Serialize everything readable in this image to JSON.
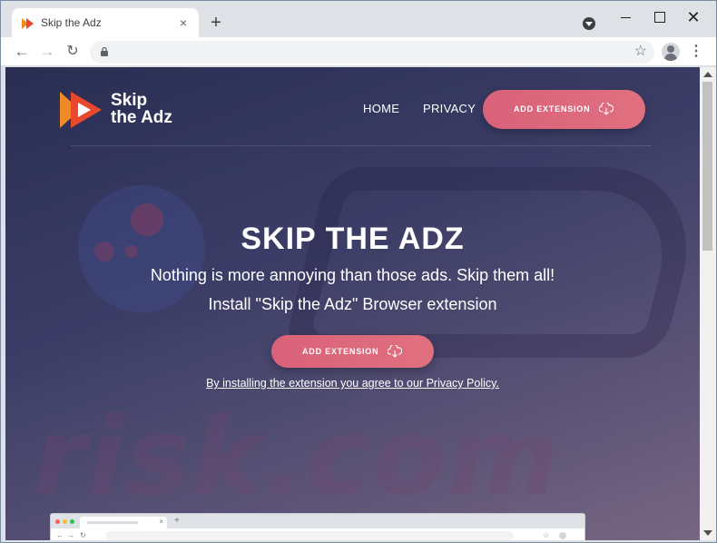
{
  "browser": {
    "tab_title": "Skip the Adz",
    "tab_close": "×",
    "new_tab": "+",
    "window_close": "✕",
    "star": "☆",
    "menu": "⋮"
  },
  "site": {
    "logo_line1": "Skip",
    "logo_line2": "the Adz",
    "nav": {
      "home": "HOME",
      "privacy": "PRIVACY",
      "cta": "ADD EXTENSION"
    },
    "hero": {
      "title": "SKIP THE ADZ",
      "subtitle1": "Nothing is more annoying than those ads. Skip them all!",
      "subtitle2": "Install \"Skip the Adz\" Browser extension",
      "cta": "ADD EXTENSION",
      "policy": "By installing the extension you agree to our Privacy Policy."
    },
    "watermark": "risk.com"
  },
  "colors": {
    "accent": "#d9627a",
    "logo_orange": "#f08a24",
    "logo_red": "#e8482c"
  },
  "icons": [
    "play-logo-icon",
    "close-icon",
    "plus-icon",
    "back-icon",
    "forward-icon",
    "reload-icon",
    "lock-icon",
    "star-icon",
    "avatar-icon",
    "menu-icon",
    "cloud-download-icon"
  ]
}
